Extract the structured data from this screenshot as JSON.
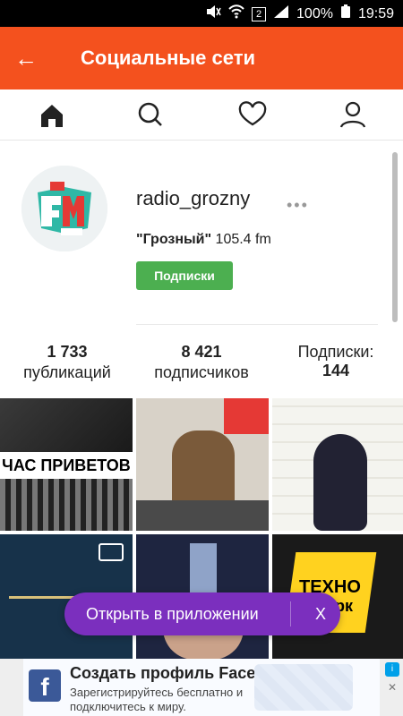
{
  "status": {
    "battery": "100%",
    "time": "19:59",
    "sim": "2"
  },
  "appbar": {
    "title": "Социальные сети",
    "back_label": "←"
  },
  "tabs": [
    {
      "name": "home"
    },
    {
      "name": "search"
    },
    {
      "name": "activity"
    },
    {
      "name": "profile"
    }
  ],
  "profile": {
    "username": "radio_grozny",
    "display_name_bold": "\"Грозный\"",
    "display_name_rest": " 105.4 fm",
    "follow_button": "Подписки",
    "more": "•••"
  },
  "stats": {
    "posts": {
      "value": "1 733",
      "label": "публикаций"
    },
    "followers": {
      "value": "8 421",
      "label": "подписчиков"
    },
    "following": {
      "value": "144",
      "label": "Подписки:"
    }
  },
  "grid": {
    "tile1_text": "ЧАС ПРИВЕТОВ",
    "tile6_text": "ТЕХНО",
    "tile6_text2": "рк"
  },
  "open_app": {
    "label": "Открыть в приложении",
    "close": "X"
  },
  "ad": {
    "headline": "Создать профиль Facebook",
    "subtext": "Зарегистрируйтесь бесплатно и подключитесь к миру.",
    "fb_letter": "f",
    "adchoices": "i",
    "close": "✕"
  }
}
